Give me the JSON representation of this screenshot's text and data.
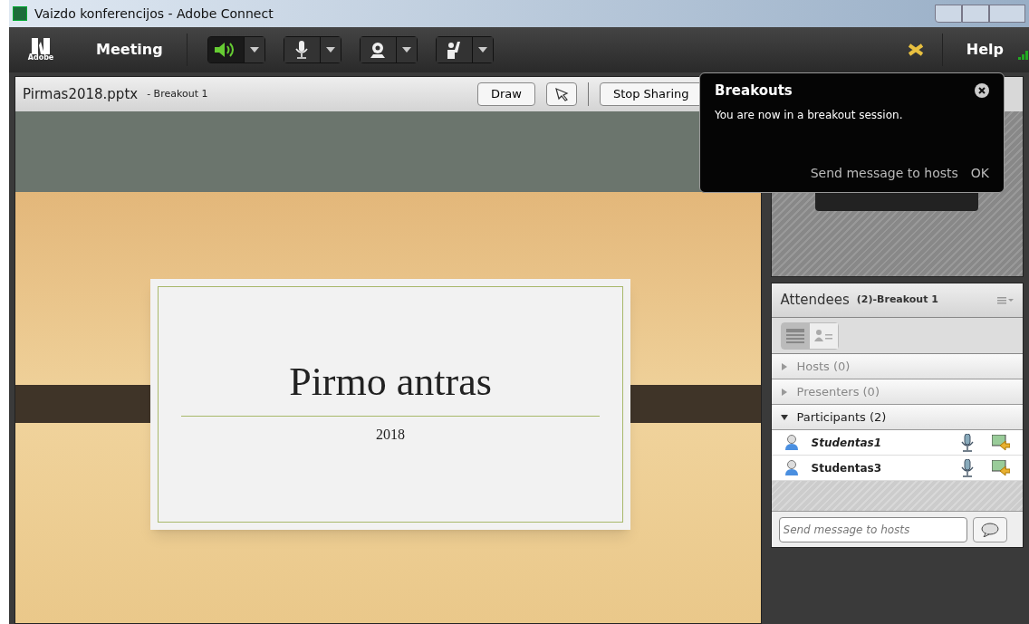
{
  "window": {
    "title": "Vaizdo konferencijos - Adobe Connect"
  },
  "menubar": {
    "logo": "Adobe",
    "meeting": "Meeting",
    "help": "Help",
    "audio_on": true
  },
  "share_pod": {
    "file": "Pirmas2018.pptx",
    "room": "- Breakout 1",
    "buttons": [
      "Draw",
      "Stop Sharing"
    ]
  },
  "slide": {
    "title": "Pirmo antras",
    "subtitle": "2018"
  },
  "popup": {
    "title": "Breakouts",
    "message": "You are now in a breakout session.",
    "actions": [
      "Send message to hosts",
      "OK"
    ]
  },
  "attendees": {
    "title": "Attendees",
    "count": "(2)-Breakout 1",
    "views": [
      {
        "kind": "list",
        "selected": true
      },
      {
        "kind": "cards",
        "selected": false
      }
    ],
    "groups": [
      {
        "label": "Hosts (0)",
        "expanded": false
      },
      {
        "label": "Presenters (0)",
        "expanded": false
      },
      {
        "label": "Participants (2)",
        "expanded": true,
        "people": [
          {
            "name": "Studentas1",
            "current": true
          },
          {
            "name": "Studentas3",
            "current": false
          }
        ]
      }
    ],
    "message": {
      "placeholder": "Send message to hosts"
    }
  }
}
